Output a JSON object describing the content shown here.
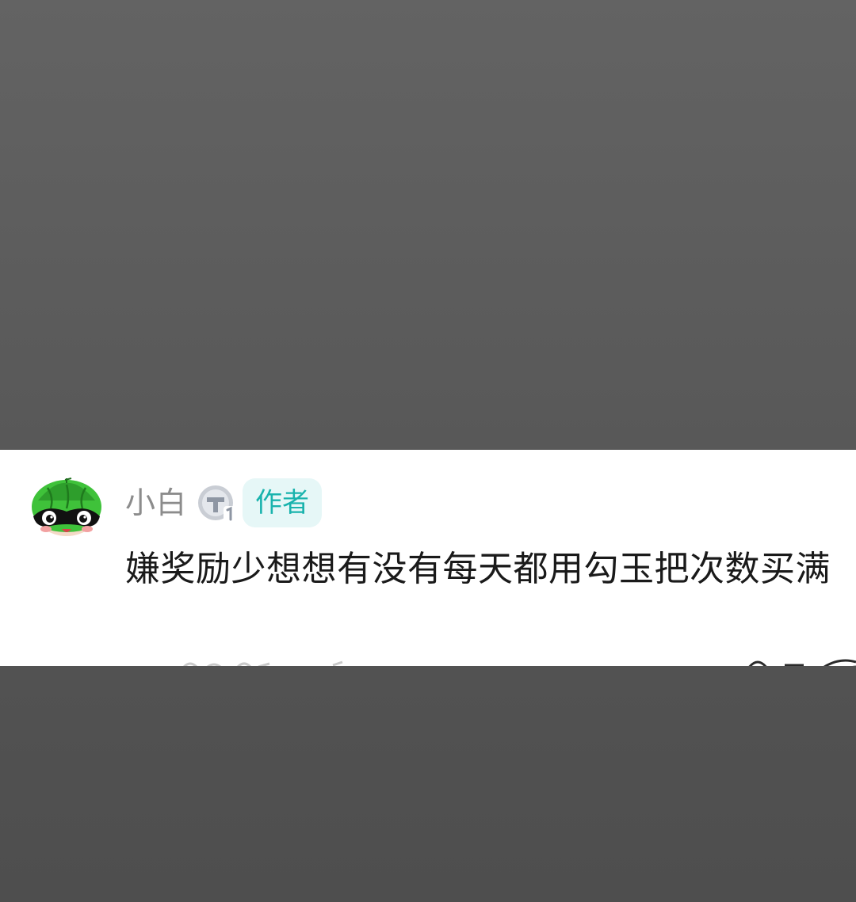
{
  "comment": {
    "username": "小白",
    "level_badge_icon": "level-t1-badge-icon",
    "author_tag": "作者",
    "text": "嫌奖励少想想有没有每天都用勾玉把次数买满"
  },
  "colors": {
    "overlay": "#585858",
    "card_background": "#ffffff",
    "username": "#8c8c8c",
    "author_tag_text": "#19b3ad",
    "author_tag_background": "#e6f7f7",
    "comment_text": "#1a1a1a",
    "avatar_green": "#3fc23a"
  }
}
